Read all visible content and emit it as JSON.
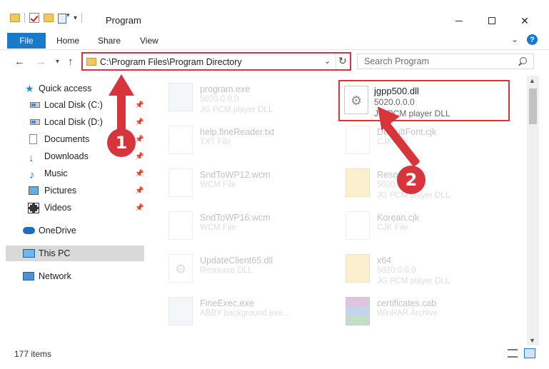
{
  "window": {
    "title": "Program",
    "minimize_glyph": "",
    "maximize_glyph": "",
    "close_glyph": "✕"
  },
  "ribbon": {
    "tabs": [
      "File",
      "Home",
      "Share",
      "View"
    ],
    "expand_glyph": "⌄",
    "help_glyph": "?"
  },
  "navigation": {
    "back_glyph": "←",
    "forward_glyph": "→",
    "recent_glyph": "▾",
    "up_glyph": "↑",
    "address": "C:\\Program Files\\Program Directory",
    "address_drop_glyph": "⌄",
    "refresh_glyph": "↻",
    "search_placeholder": "Search Program"
  },
  "sidebar": {
    "items": [
      {
        "label": "Quick access",
        "icon": "star-icon"
      },
      {
        "label": "Local Disk (C:)",
        "icon": "disk-icon",
        "pinned": true
      },
      {
        "label": "Local Disk (D:)",
        "icon": "disk-icon",
        "pinned": true
      },
      {
        "label": "Documents",
        "icon": "documents-icon",
        "pinned": true
      },
      {
        "label": "Downloads",
        "icon": "download-icon",
        "pinned": true
      },
      {
        "label": "Music",
        "icon": "music-icon",
        "pinned": true
      },
      {
        "label": "Pictures",
        "icon": "pictures-icon",
        "pinned": true
      },
      {
        "label": "Videos",
        "icon": "video-icon",
        "pinned": true
      },
      {
        "label": "OneDrive",
        "icon": "cloud-icon"
      },
      {
        "label": "This PC",
        "icon": "pc-icon",
        "selected": true
      },
      {
        "label": "Network",
        "icon": "network-icon"
      }
    ],
    "pin_glyph": "📌"
  },
  "files": [
    {
      "name": "program.exe",
      "line2": "5020.0.0.0",
      "line3": "JG PCM player DLL",
      "icon": "exe-icon"
    },
    {
      "name": "jgpp500.dll",
      "line2": "5020.0.0.0",
      "line3": "JG PCM player DLL",
      "icon": "dll-gear-icon",
      "highlighted": true
    },
    {
      "name": "help.fineReader.txt",
      "line2": "TXT File",
      "line3": "",
      "icon": "document-icon"
    },
    {
      "name": "DefaultFont.cjk",
      "line2": "CJK File",
      "line3": "",
      "icon": "document-icon"
    },
    {
      "name": "SndToWP12.wcm",
      "line2": "WCM File",
      "line3": "",
      "icon": "document-icon"
    },
    {
      "name": "Resources",
      "line2": "5020.0.0.0",
      "line3": "JG PCM player DLL",
      "icon": "folder-file-icon"
    },
    {
      "name": "SndToWP16.wcm",
      "line2": "WCM File",
      "line3": "",
      "icon": "document-icon"
    },
    {
      "name": "Korean.cjk",
      "line2": "CJK File",
      "line3": "",
      "icon": "document-icon"
    },
    {
      "name": "UpdateClient65.dll",
      "line2": "Resource DLL",
      "line3": "",
      "icon": "dll-gear-icon"
    },
    {
      "name": "x64",
      "line2": "5020.0.0.0",
      "line3": "JG PCM player DLL",
      "icon": "folder-file-icon"
    },
    {
      "name": "FineExec.exe",
      "line2": "ABBY background exe...",
      "line3": "",
      "icon": "exe-icon"
    },
    {
      "name": "certificates.cab",
      "line2": "WinRAR Archive",
      "line3": "",
      "icon": "rar-icon"
    }
  ],
  "status": {
    "item_count": "177 items"
  },
  "annotations": {
    "marker_1": "1",
    "marker_2": "2",
    "color": "#d8343c"
  },
  "scrollbar": {
    "up_glyph": "▲",
    "down_glyph": "▼"
  }
}
